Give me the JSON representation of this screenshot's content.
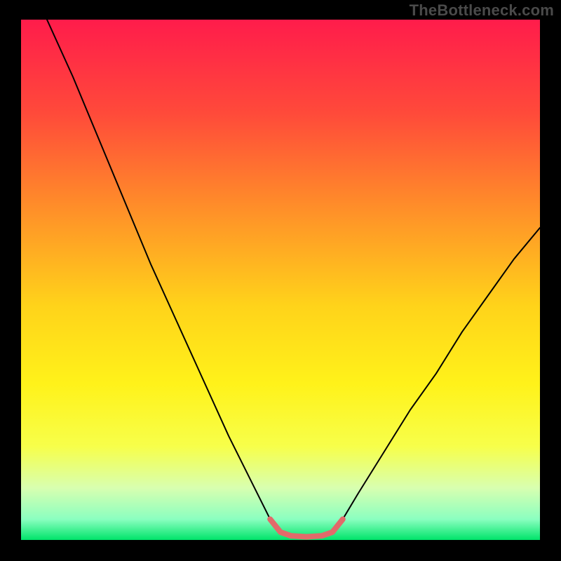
{
  "watermark": "TheBottleneck.com",
  "chart_data": {
    "type": "line",
    "title": "",
    "xlabel": "",
    "ylabel": "",
    "xlim": [
      0,
      100
    ],
    "ylim": [
      0,
      100
    ],
    "grid": false,
    "legend": false,
    "background_gradient_stops": [
      {
        "offset": 0,
        "color": "#ff1c4b"
      },
      {
        "offset": 18,
        "color": "#ff4a3a"
      },
      {
        "offset": 35,
        "color": "#ff8a2a"
      },
      {
        "offset": 55,
        "color": "#ffd31a"
      },
      {
        "offset": 70,
        "color": "#fff21a"
      },
      {
        "offset": 82,
        "color": "#f7ff4a"
      },
      {
        "offset": 90,
        "color": "#d8ffb0"
      },
      {
        "offset": 96,
        "color": "#8bffc0"
      },
      {
        "offset": 100,
        "color": "#00e46a"
      }
    ],
    "series": [
      {
        "name": "bottleneck-curve",
        "stroke": "#000000",
        "stroke_width": 2,
        "points": [
          {
            "x": 5,
            "y": 100
          },
          {
            "x": 10,
            "y": 89
          },
          {
            "x": 15,
            "y": 77
          },
          {
            "x": 20,
            "y": 65
          },
          {
            "x": 25,
            "y": 53
          },
          {
            "x": 30,
            "y": 42
          },
          {
            "x": 35,
            "y": 31
          },
          {
            "x": 40,
            "y": 20
          },
          {
            "x": 45,
            "y": 10
          },
          {
            "x": 48,
            "y": 4
          },
          {
            "x": 50,
            "y": 1.5
          },
          {
            "x": 52,
            "y": 0.8
          },
          {
            "x": 55,
            "y": 0.6
          },
          {
            "x": 58,
            "y": 0.8
          },
          {
            "x": 60,
            "y": 1.5
          },
          {
            "x": 62,
            "y": 4
          },
          {
            "x": 65,
            "y": 9
          },
          {
            "x": 70,
            "y": 17
          },
          {
            "x": 75,
            "y": 25
          },
          {
            "x": 80,
            "y": 32
          },
          {
            "x": 85,
            "y": 40
          },
          {
            "x": 90,
            "y": 47
          },
          {
            "x": 95,
            "y": 54
          },
          {
            "x": 100,
            "y": 60
          }
        ]
      },
      {
        "name": "optimal-zone-highlight",
        "stroke": "#e26a6a",
        "stroke_width": 8,
        "points": [
          {
            "x": 48,
            "y": 4
          },
          {
            "x": 50,
            "y": 1.5
          },
          {
            "x": 52,
            "y": 0.8
          },
          {
            "x": 55,
            "y": 0.6
          },
          {
            "x": 58,
            "y": 0.8
          },
          {
            "x": 60,
            "y": 1.5
          },
          {
            "x": 62,
            "y": 4
          }
        ]
      }
    ]
  }
}
